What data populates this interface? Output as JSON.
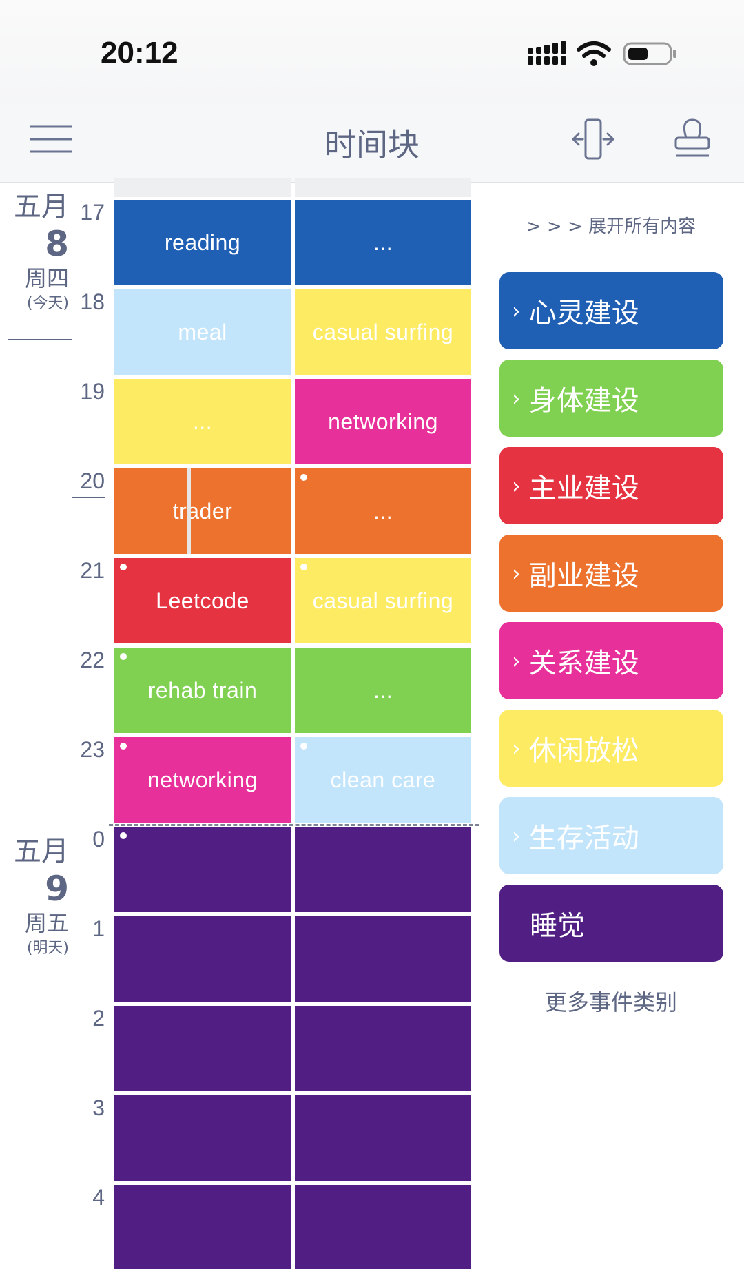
{
  "status_bar": {
    "time": "20:12"
  },
  "nav": {
    "title": "时间块"
  },
  "dates": [
    {
      "month": "五月",
      "day": "8",
      "weekday": "周四",
      "relative": "(今天)"
    },
    {
      "month": "五月",
      "day": "9",
      "weekday": "周五",
      "relative": "(明天)"
    }
  ],
  "hours": [
    "17",
    "18",
    "19",
    "20",
    "21",
    "22",
    "23",
    "0",
    "1",
    "2",
    "3",
    "4"
  ],
  "time_blocks": {
    "h17": {
      "left": "reading",
      "right": "..."
    },
    "h18": {
      "left": "meal",
      "right": "casual surfing"
    },
    "h19": {
      "left": "...",
      "right": "networking"
    },
    "h20": {
      "left": "trader",
      "right": "..."
    },
    "h21": {
      "left": "Leetcode",
      "right": "casual surfing"
    },
    "h22": {
      "left": "rehab train",
      "right": "..."
    },
    "h23": {
      "left": "networking",
      "right": "clean care"
    }
  },
  "panel": {
    "expand_all": "> > >  展开所有内容",
    "chevron": "›",
    "categories": [
      {
        "label": "心灵建设",
        "color": "#1f5fb4"
      },
      {
        "label": "身体建设",
        "color": "#80d051"
      },
      {
        "label": "主业建设",
        "color": "#e63342"
      },
      {
        "label": "副业建设",
        "color": "#ec722d"
      },
      {
        "label": "关系建设",
        "color": "#e8309a"
      },
      {
        "label": "休闲放松",
        "color": "#fdeb63"
      },
      {
        "label": "生存活动",
        "color": "#c3e5fb"
      },
      {
        "label": "睡觉",
        "color": "#511f83"
      }
    ],
    "more": "更多事件类别"
  },
  "colors": {
    "blue": "#1f5fb4",
    "light_blue": "#c3e5fb",
    "yellow": "#fdeb63",
    "pink": "#e8309a",
    "orange": "#ec722d",
    "red": "#e63342",
    "green": "#80d051",
    "purple": "#511f83"
  }
}
